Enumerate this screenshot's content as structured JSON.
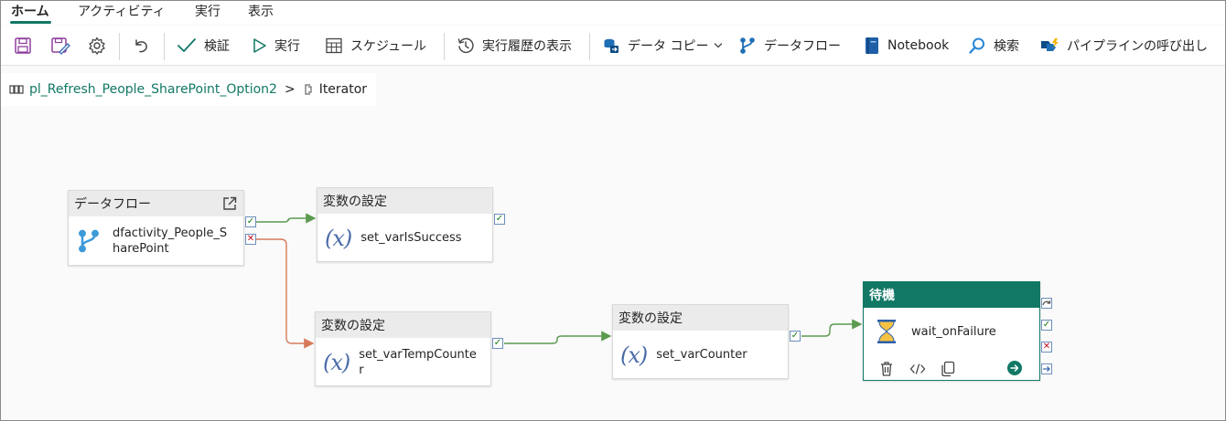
{
  "menu_tabs": [
    {
      "label": "ホーム",
      "active": true
    },
    {
      "label": "アクティビティ",
      "active": false
    },
    {
      "label": "実行",
      "active": false
    },
    {
      "label": "表示",
      "active": false
    }
  ],
  "toolbar": {
    "save_icon": "save-icon",
    "save_as_template_icon": "save-as-template-icon",
    "settings_icon": "gear-icon",
    "undo_icon": "undo-icon",
    "validate": "検証",
    "run": "実行",
    "schedule": "スケジュール",
    "view_run_history": "実行履歴の表示",
    "copy_data": "データ コピー",
    "dataflow": "データフロー",
    "notebook": "Notebook",
    "search": "検索",
    "invoke_pipeline": "パイプラインの呼び出し"
  },
  "breadcrumb": {
    "pipeline": "pl_Refresh_People_SharePoint_Option2",
    "separator": ">",
    "current": "Iterator"
  },
  "nodes": {
    "dataflow": {
      "type": "データフロー",
      "name_line1": "dfactivity_People_S",
      "name_line2": "harePoint"
    },
    "set_success": {
      "type": "変数の設定",
      "name": "set_varIsSuccess"
    },
    "set_temp": {
      "type": "変数の設定",
      "name_line1": "set_varTempCounte",
      "name_line2": "r"
    },
    "set_counter": {
      "type": "変数の設定",
      "name": "set_varCounter"
    },
    "wait": {
      "type": "待機",
      "name": "wait_onFailure"
    }
  },
  "colors": {
    "accent": "#117865",
    "success": "#107c10",
    "failure": "#c50f1f",
    "success_line": "#5b9a4f",
    "failure_line": "#d77a5a"
  }
}
